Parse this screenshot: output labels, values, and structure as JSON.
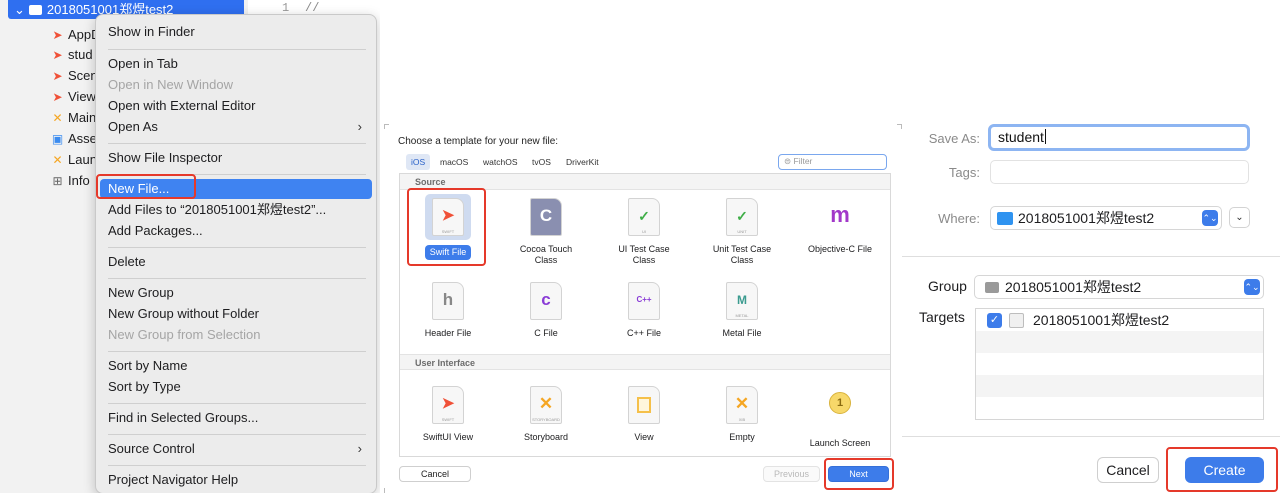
{
  "navigator": {
    "project_name": "2018051001郑煜test2",
    "gutter_line": "1",
    "gutter_code": "//",
    "items": [
      {
        "label": "AppD",
        "icon": "swift-file-icon"
      },
      {
        "label": "stud",
        "icon": "swift-file-icon"
      },
      {
        "label": "Scen",
        "icon": "swift-file-icon"
      },
      {
        "label": "View",
        "icon": "swift-file-icon"
      },
      {
        "label": "Main",
        "icon": "storyboard-icon"
      },
      {
        "label": "Asse",
        "icon": "asset-catalog-icon"
      },
      {
        "label": "Laun",
        "icon": "storyboard-icon"
      },
      {
        "label": "Info",
        "icon": "plist-table-icon"
      }
    ]
  },
  "context_menu": {
    "show_in_finder": "Show in Finder",
    "open_in_tab": "Open in Tab",
    "open_in_new_window": "Open in New Window",
    "open_with_external_editor": "Open with External Editor",
    "open_as": "Open As",
    "show_file_inspector": "Show File Inspector",
    "new_file": "New File...",
    "add_files": "Add Files to “2018051001郑煜test2”...",
    "add_packages": "Add Packages...",
    "delete": "Delete",
    "new_group": "New Group",
    "new_group_without_folder": "New Group without Folder",
    "new_group_from_selection": "New Group from Selection",
    "sort_by_name": "Sort by Name",
    "sort_by_type": "Sort by Type",
    "find_in_selected_groups": "Find in Selected Groups...",
    "source_control": "Source Control",
    "project_navigator_help": "Project Navigator Help",
    "submenu_glyph": "›"
  },
  "template_chooser": {
    "title": "Choose a template for your new file:",
    "tabs": [
      "iOS",
      "macOS",
      "watchOS",
      "tvOS",
      "DriverKit"
    ],
    "selected_tab": "iOS",
    "filter_placeholder": "Filter",
    "section_source": "Source",
    "section_ui": "User Interface",
    "source_templates": [
      {
        "label": "Swift File",
        "glyph": "",
        "sub": "SWIFT"
      },
      {
        "label": "Cocoa Touch\nClass",
        "glyph": "C",
        "sub": ""
      },
      {
        "label": "UI Test Case\nClass",
        "glyph": "✓",
        "sub": "UI"
      },
      {
        "label": "Unit Test Case\nClass",
        "glyph": "✓",
        "sub": "UNIT"
      },
      {
        "label": "Objective-C File",
        "glyph": "m",
        "sub": ""
      },
      {
        "label": "Header File",
        "glyph": "h",
        "sub": ""
      },
      {
        "label": "C File",
        "glyph": "c",
        "sub": ""
      },
      {
        "label": "C++ File",
        "glyph": "C++",
        "sub": ""
      },
      {
        "label": "Metal File",
        "glyph": "M",
        "sub": "METAL"
      }
    ],
    "ui_templates": [
      {
        "label": "SwiftUI View",
        "glyph": "",
        "sub": "SWIFT"
      },
      {
        "label": "Storyboard",
        "glyph": "✕",
        "sub": "STORYBOARD"
      },
      {
        "label": "View",
        "glyph": "",
        "sub": ""
      },
      {
        "label": "Empty",
        "glyph": "✕",
        "sub": "XIB"
      },
      {
        "label": "Launch Screen",
        "glyph": "1",
        "sub": ""
      }
    ],
    "cancel_label": "Cancel",
    "previous_label": "Previous",
    "next_label": "Next"
  },
  "save_dialog": {
    "save_as_label": "Save As:",
    "save_as_value": "student",
    "tags_label": "Tags:",
    "where_label": "Where:",
    "where_value": "2018051001郑煜test2",
    "group_label": "Group",
    "group_value": "2018051001郑煜test2",
    "targets_label": "Targets",
    "target_name": "2018051001郑煜test2",
    "target_checked": true,
    "cancel_label": "Cancel",
    "create_label": "Create",
    "popup_arrows": "⌃⌄",
    "expand_glyph": "⌄",
    "check_glyph": "✓"
  },
  "colors": {
    "accent": "#3d7cea",
    "highlight_box": "#e5392a",
    "menu_selection": "#3f83f1"
  }
}
